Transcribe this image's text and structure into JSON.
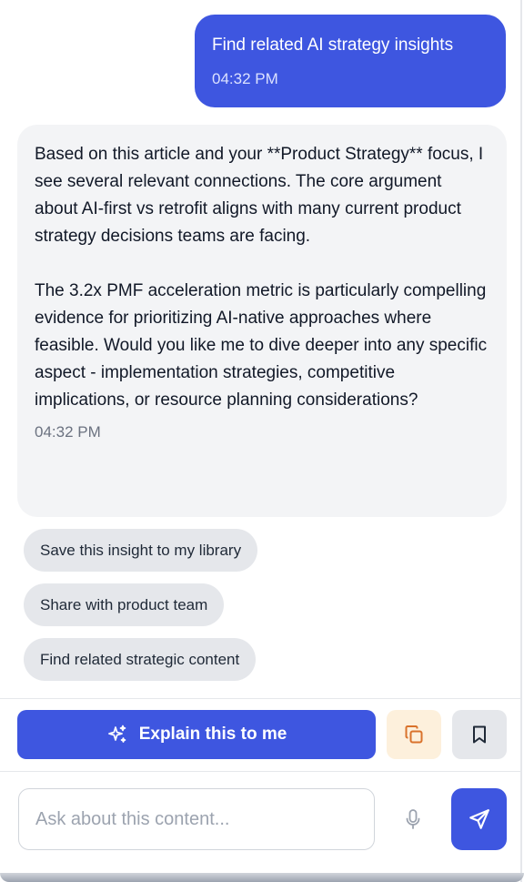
{
  "messages": {
    "user": {
      "text": "Find related AI strategy insights",
      "time": "04:32 PM"
    },
    "assistant": {
      "text": "Based on this article and your **Product Strategy** focus, I see several relevant connections. The core argument about AI-first vs retrofit aligns with many current product strategy decisions teams are facing.\n\nThe 3.2x PMF acceleration metric is particularly compelling evidence for prioritizing AI-native approaches where feasible. Would you like me to dive deeper into any specific aspect - implementation strategies, competitive implications, or resource planning considerations?",
      "time": "04:32 PM"
    }
  },
  "suggestions": [
    "Save this insight to my library",
    "Share with product team",
    "Find related strategic content"
  ],
  "actions": {
    "explain_label": "Explain this to me",
    "explain_icon": "sparkles-icon",
    "copy_icon": "copy-icon",
    "bookmark_icon": "bookmark-icon"
  },
  "composer": {
    "placeholder": "Ask about this content...",
    "value": "",
    "mic_icon": "microphone-icon",
    "send_icon": "send-icon"
  },
  "colors": {
    "accent": "#3e56e0",
    "assistant_bubble": "#f3f4f6",
    "chip": "#e5e7eb",
    "copy_button": "#fdf0dc",
    "copy_icon": "#d9722b"
  }
}
